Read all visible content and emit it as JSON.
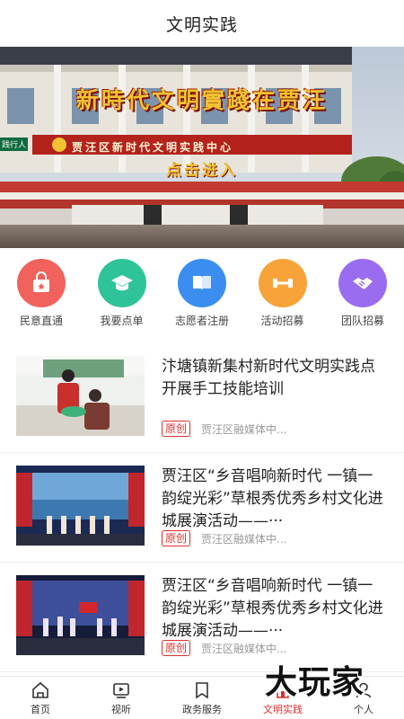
{
  "header": {
    "title": "文明实践"
  },
  "banner": {
    "title": "新時代文明實踐在贾汪",
    "sign": "贾汪区新时代文明实践中心",
    "enter": "点击进入",
    "left_sign": "践行人"
  },
  "quick_actions": [
    {
      "label": "民意直通",
      "icon": "basket-icon",
      "color": "#f0625b"
    },
    {
      "label": "我要点单",
      "icon": "graduation-cap-icon",
      "color": "#2fc39a"
    },
    {
      "label": "志愿者注册",
      "icon": "book-icon",
      "color": "#3b8ef0"
    },
    {
      "label": "活动招募",
      "icon": "dumbbell-icon",
      "color": "#f7a33a"
    },
    {
      "label": "团队招募",
      "icon": "handshake-icon",
      "color": "#9a6cf0"
    }
  ],
  "news": [
    {
      "title": "汴塘镇新集村新时代文明实践点开展手工技能培训",
      "tag": "原创",
      "source": "贾汪区融媒体中..."
    },
    {
      "title": "贾汪区“乡音唱响新时代 一镇一韵绽光彩”草根秀优秀乡村文化进城展演活动——···",
      "tag": "原创",
      "source": "贾汪区融媒体中..."
    },
    {
      "title": "贾汪区“乡音唱响新时代 一镇一韵绽光彩”草根秀优秀乡村文化进城展演活动——···",
      "tag": "原创",
      "source": "贾汪区融媒体中..."
    }
  ],
  "tabs": [
    {
      "label": "首页",
      "icon": "home-icon"
    },
    {
      "label": "视听",
      "icon": "video-icon"
    },
    {
      "label": "政务服务",
      "icon": "bookmark-icon"
    },
    {
      "label": "文明实践",
      "icon": "building-icon",
      "active": true
    },
    {
      "label": "个人",
      "icon": "user-icon"
    }
  ],
  "watermark": "大玩家"
}
